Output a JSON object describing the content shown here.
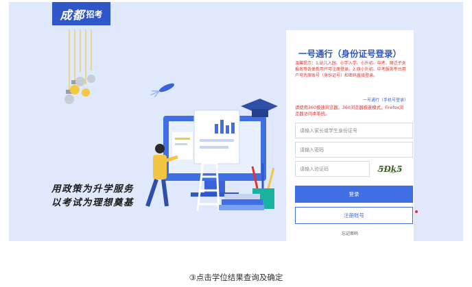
{
  "logo": {
    "script": "成都",
    "word": "招考"
  },
  "slogan": {
    "line1": "用政策为升学服务",
    "line2": "以考试为理想奠基"
  },
  "login": {
    "title": "一号通行（身份证号登录）",
    "tip": "温馨提示：1.幼儿入园、小学入学、小升初、中考、随迁子女报名等各类新用户可注册登录。2.原小升初、中考服务平台用户可凭原账号（身份证号）和密码直接登录。",
    "switch_link": "一号通行（手机号登录）",
    "browser_notice": "请使用360极速浏览器，360浏览器极速模式，Firefox浏览器访问本系统。",
    "id_placeholder": "请输入家长或学生身份证号",
    "password_placeholder": "请输入密码",
    "captcha_placeholder": "请输入验证码",
    "captcha_text": "5Dk5",
    "login_button": "登录",
    "register_button": "注册账号",
    "forgot_link": "忘记密码"
  },
  "caption": "③点击学位结果查询及确定",
  "colors": {
    "accent": "#2d55c4",
    "button": "#3f6fe2",
    "warning": "#e4312f",
    "background": "#dfe9fb"
  }
}
